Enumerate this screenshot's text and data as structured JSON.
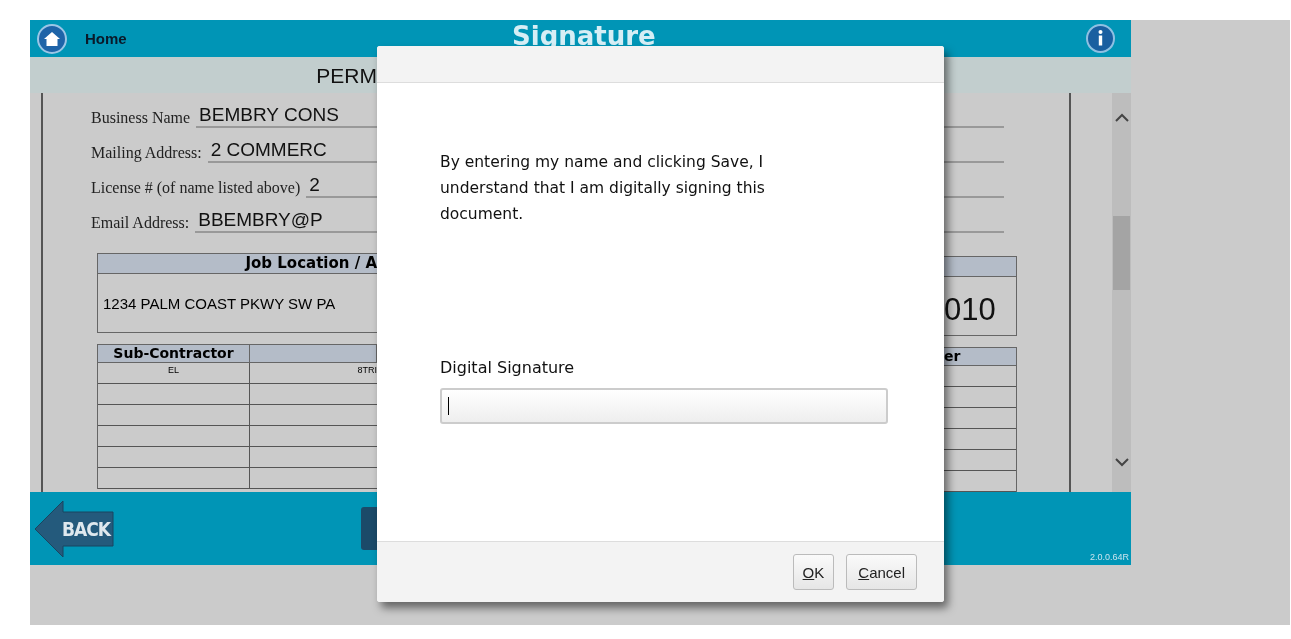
{
  "header": {
    "home_label": "Home",
    "title": "Signature"
  },
  "document": {
    "heading": "PERM",
    "fields": [
      {
        "label": "Business Name",
        "value": "BEMBRY CONS"
      },
      {
        "label": "Mailing Address:",
        "value": "2 COMMERC"
      },
      {
        "label": "License # (of name listed above)",
        "value": "2"
      },
      {
        "label": "Email Address:",
        "value": "BBEMBRY@P"
      }
    ],
    "job_location": {
      "header": "Job Location / A",
      "address": "1234 PALM COAST PKWY SW PA",
      "number_tail": "010"
    },
    "subcontractors": {
      "column_1": "Sub-Contractor",
      "column_3": "er",
      "rows": [
        [
          "EL",
          "8TRI"
        ],
        [
          "",
          ""
        ],
        [
          "",
          ""
        ],
        [
          "",
          ""
        ],
        [
          "",
          ""
        ],
        [
          "",
          ""
        ]
      ]
    }
  },
  "footer": {
    "back_label": "BACK",
    "version": "2.0.0.64R"
  },
  "dialog": {
    "message": "By entering my name and clicking Save, I understand that I am digitally signing this document.",
    "field_label": "Digital Signature",
    "field_focused": true,
    "buttons": [
      "OK",
      "Cancel"
    ]
  }
}
